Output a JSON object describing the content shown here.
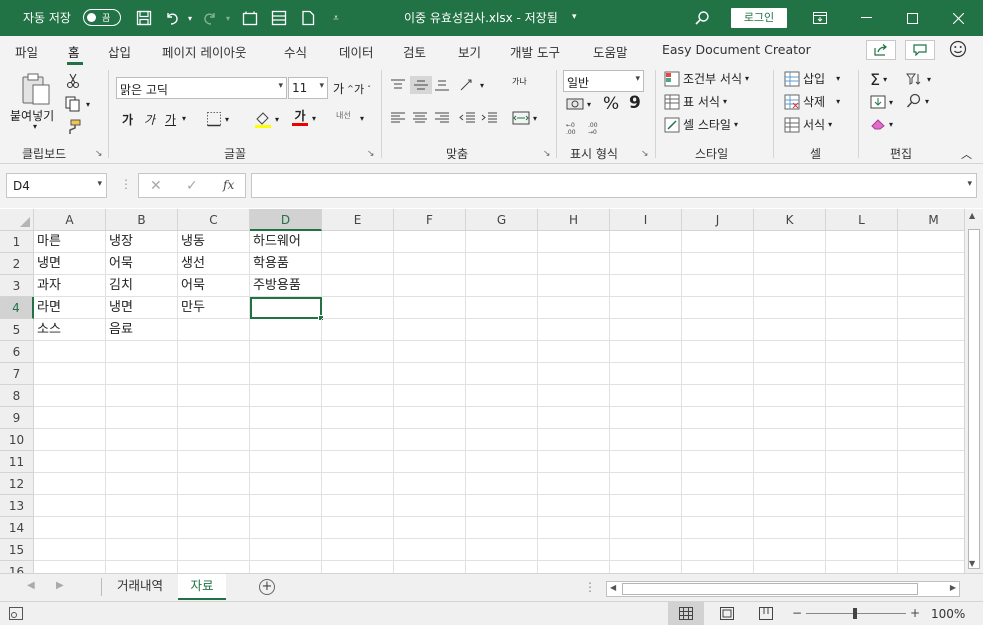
{
  "titlebar": {
    "autosave_label": "자동 저장",
    "autosave_state": "끔",
    "doc_title": "이중 유효성검사.xlsx - 저장됨",
    "login": "로그인"
  },
  "tabs": [
    "파일",
    "홈",
    "삽입",
    "페이지 레이아웃",
    "수식",
    "데이터",
    "검토",
    "보기",
    "개발 도구",
    "도움말",
    "Easy Document Creator"
  ],
  "active_tab": "홈",
  "ribbon": {
    "clipboard": {
      "paste": "붙여넣기",
      "label": "클립보드"
    },
    "font": {
      "name": "맑은 고딕",
      "size": "11",
      "grow": "가",
      "shrink": "가",
      "bold": "가",
      "italic": "가",
      "underline": "가",
      "font_color_glyph": "가",
      "phonetic": "내선",
      "label": "글꼴"
    },
    "alignment": {
      "wrap": "가나",
      "label": "맞춤"
    },
    "number": {
      "format": "일반",
      "percent": "%",
      "comma": "9",
      "label": "표시 형식"
    },
    "styles": {
      "conditional": "조건부 서식",
      "table": "표 서식",
      "cell": "셀 스타일",
      "label": "스타일"
    },
    "cells": {
      "insert": "삽입",
      "delete": "삭제",
      "format": "서식",
      "label": "셀"
    },
    "editing": {
      "label": "편집"
    }
  },
  "formula_bar": {
    "name_box": "D4",
    "fx": "fx",
    "content": ""
  },
  "grid": {
    "columns": [
      "A",
      "B",
      "C",
      "D",
      "E",
      "F",
      "G",
      "H",
      "I",
      "J",
      "K",
      "L",
      "M"
    ],
    "rows": [
      "1",
      "2",
      "3",
      "4",
      "5",
      "6",
      "7",
      "8",
      "9",
      "10",
      "11",
      "12",
      "13",
      "14",
      "15",
      "16"
    ],
    "selected_cell": "D4",
    "cells": [
      [
        "마른",
        "냉장",
        "냉동",
        "하드웨어"
      ],
      [
        "냉면",
        "어묵",
        "생선",
        "학용품"
      ],
      [
        "과자",
        "김치",
        "어묵",
        "주방용품"
      ],
      [
        "라면",
        "냉면",
        "만두",
        ""
      ],
      [
        "소스",
        "음료",
        "",
        ""
      ]
    ]
  },
  "sheets": [
    "거래내역",
    "자료"
  ],
  "active_sheet": "자료",
  "status": {
    "zoom": "100%"
  }
}
